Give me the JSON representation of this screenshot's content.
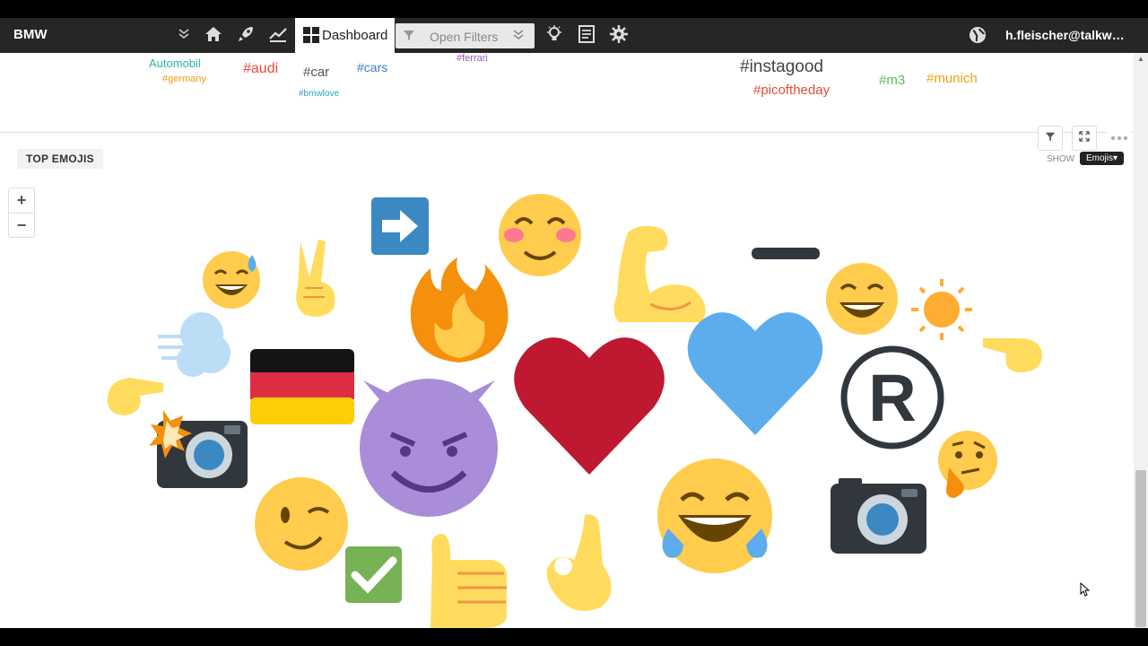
{
  "app": {
    "brand": "BMW",
    "user": "h.fleischer@talkwalke...",
    "tab_dashboard": "Dashboard",
    "filters_placeholder": "Open Filters"
  },
  "hashtags": [
    {
      "text": "Automobil",
      "color": "#29b6a8"
    },
    {
      "text": "#germany",
      "color": "#f39c12"
    },
    {
      "text": "#audi",
      "color": "#e74c3c"
    },
    {
      "text": "#car",
      "color": "#555555"
    },
    {
      "text": "#cars",
      "color": "#3b7fc4"
    },
    {
      "text": "#bmwlove",
      "color": "#29a3c4"
    },
    {
      "text": "#ferrari",
      "color": "#9b59b6"
    },
    {
      "text": "#instagood",
      "color": "#444444"
    },
    {
      "text": "#picoftheday",
      "color": "#e74c3c"
    },
    {
      "text": "#m3",
      "color": "#5cb85c"
    },
    {
      "text": "#munich",
      "color": "#f0a30a"
    }
  ],
  "panel": {
    "title": "TOP EMOJIS",
    "show_label": "SHOW",
    "show_value": "Emojis▾"
  },
  "icons": [
    "home-icon",
    "rocket-icon",
    "chart-icon",
    "bulb-icon",
    "report-icon",
    "gear-icon",
    "globe-icon",
    "filter-icon",
    "expand-icon",
    "more-icon"
  ],
  "emojis": [
    "sweat-smile",
    "victory-hand",
    "arrow-right",
    "blush",
    "fire",
    "flexed-biceps",
    "minus",
    "grin",
    "sun",
    "pointing-right",
    "dash",
    "german-flag",
    "pointing-right",
    "camera-flash",
    "smiling-imp",
    "red-heart",
    "blue-heart",
    "registered",
    "thinking",
    "wink",
    "check-mark",
    "thumbs-up",
    "ok-hand",
    "joy",
    "camera"
  ]
}
